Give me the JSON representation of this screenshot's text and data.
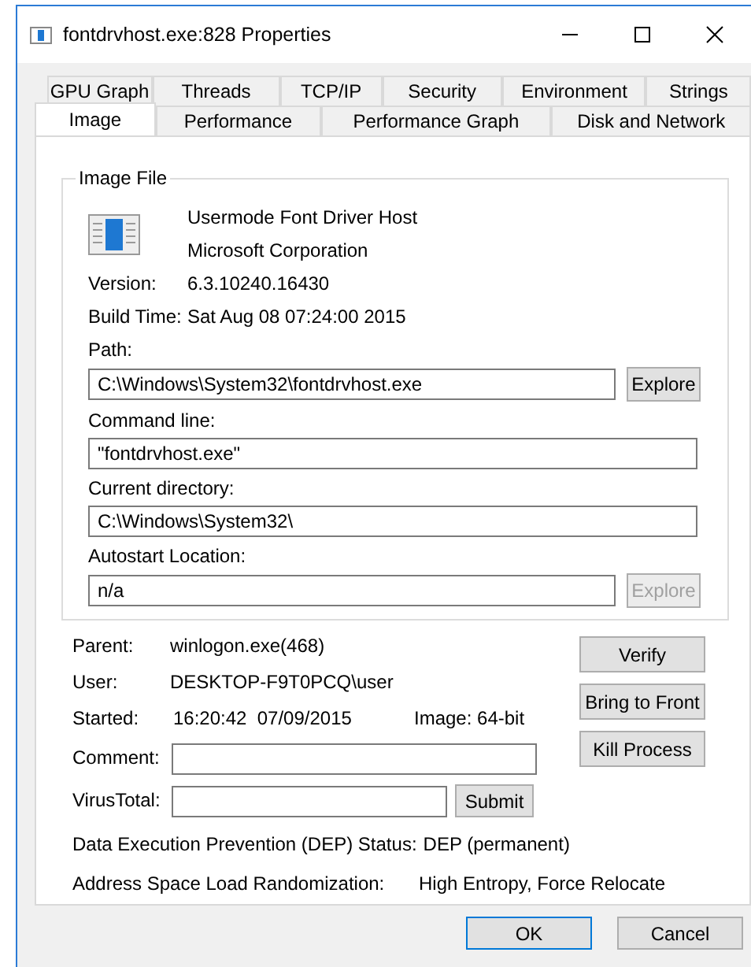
{
  "window": {
    "title": "fontdrvhost.exe:828 Properties"
  },
  "tab_rows": [
    [
      {
        "label": "GPU Graph",
        "selected": false
      },
      {
        "label": "Threads",
        "selected": false
      },
      {
        "label": "TCP/IP",
        "selected": false
      },
      {
        "label": "Security",
        "selected": false
      },
      {
        "label": "Environment",
        "selected": false
      },
      {
        "label": "Strings",
        "selected": false
      }
    ],
    [
      {
        "label": "Image",
        "selected": true
      },
      {
        "label": "Performance",
        "selected": false
      },
      {
        "label": "Performance Graph",
        "selected": false
      },
      {
        "label": "Disk and Network",
        "selected": false
      }
    ]
  ],
  "image_file": {
    "title": "Image File",
    "description": "Usermode Font Driver Host",
    "company": "Microsoft Corporation",
    "info": [
      {
        "label": "Version:",
        "value": "6.3.10240.16430"
      },
      {
        "label": "Build Time:",
        "value": "Sat Aug 08 07:24:00 2015"
      }
    ],
    "fields": [
      {
        "label": "Path:",
        "value": "C:\\Windows\\System32\\fontdrvhost.exe",
        "button": {
          "label": "Explore",
          "disabled": false
        }
      },
      {
        "label": "Command line:",
        "value": "\"fontdrvhost.exe\""
      },
      {
        "label": "Current directory:",
        "value": "C:\\Windows\\System32\\"
      },
      {
        "label": "Autostart Location:",
        "value": "n/a",
        "button": {
          "label": "Explore",
          "disabled": true
        }
      }
    ]
  },
  "process": {
    "parent": {
      "label": "Parent:",
      "value": "winlogon.exe(468)"
    },
    "user": {
      "label": "User:",
      "value": "DESKTOP-F9T0PCQ\\user"
    },
    "started": {
      "label": "Started:",
      "value": "16:20:42  07/09/2015",
      "image": "Image: 64-bit"
    },
    "comment": {
      "label": "Comment:"
    },
    "virustotal": {
      "label": "VirusTotal:",
      "button": "Submit"
    },
    "dep": {
      "label": "Data Execution Prevention (DEP) Status:",
      "value": "DEP (permanent)"
    },
    "aslr": {
      "label": "Address Space Load Randomization:",
      "value": "High Entropy, Force Relocate"
    },
    "actions": [
      {
        "label": "Verify"
      },
      {
        "label": "Bring to Front"
      },
      {
        "label": "Kill Process"
      }
    ]
  },
  "buttons": [
    {
      "label": "OK",
      "default": true
    },
    {
      "label": "Cancel",
      "default": false
    }
  ]
}
